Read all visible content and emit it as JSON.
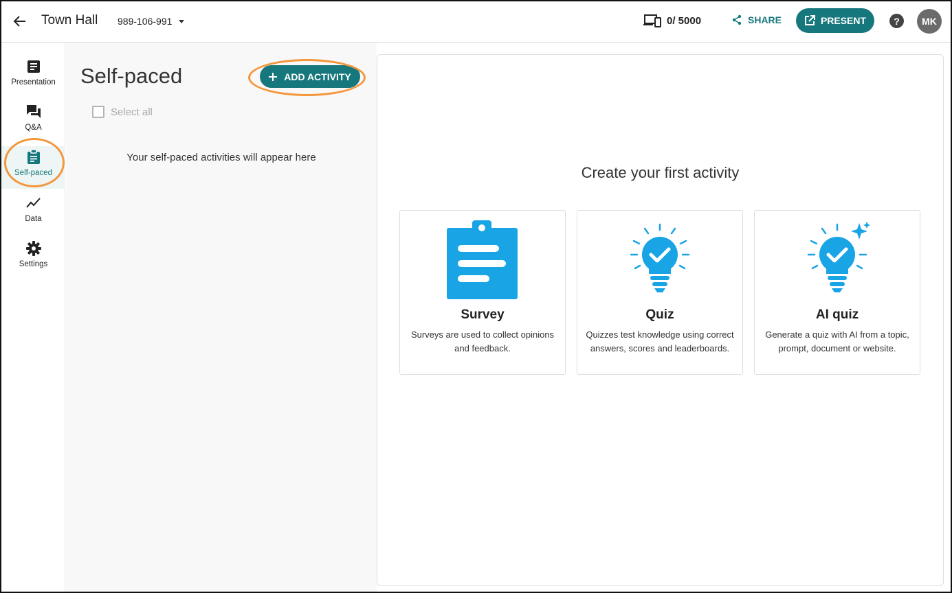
{
  "header": {
    "title": "Town Hall",
    "event_code": "989-106-991",
    "participants": "0/ 5000",
    "share_label": "SHARE",
    "present_label": "PRESENT",
    "help_label": "?",
    "avatar_initials": "MK",
    "accent_color": "#16777d"
  },
  "sidebar": {
    "items": [
      {
        "label": "Presentation",
        "icon": "presentation-icon"
      },
      {
        "label": "Q&A",
        "icon": "qa-icon"
      },
      {
        "label": "Self-paced",
        "icon": "clipboard-icon",
        "active": true
      },
      {
        "label": "Data",
        "icon": "chart-line-icon"
      },
      {
        "label": "Settings",
        "icon": "gear-icon"
      }
    ]
  },
  "panel": {
    "title": "Self-paced",
    "add_label": "ADD ACTIVITY",
    "select_all_label": "Select all",
    "empty_text": "Your self-paced activities will appear here"
  },
  "main": {
    "heading": "Create your first activity",
    "cards": [
      {
        "title": "Survey",
        "description": "Surveys are used to collect opinions and feedback.",
        "icon": "survey-clipboard-icon"
      },
      {
        "title": "Quiz",
        "description": "Quizzes test knowledge using correct answers, scores and leaderboards.",
        "icon": "lightbulb-check-icon"
      },
      {
        "title": "AI quiz",
        "description": "Generate a quiz with AI from a topic, prompt, document or website.",
        "icon": "lightbulb-sparkle-icon"
      }
    ]
  },
  "highlight_color": "#f4963a",
  "icon_color": "#19a4e6"
}
